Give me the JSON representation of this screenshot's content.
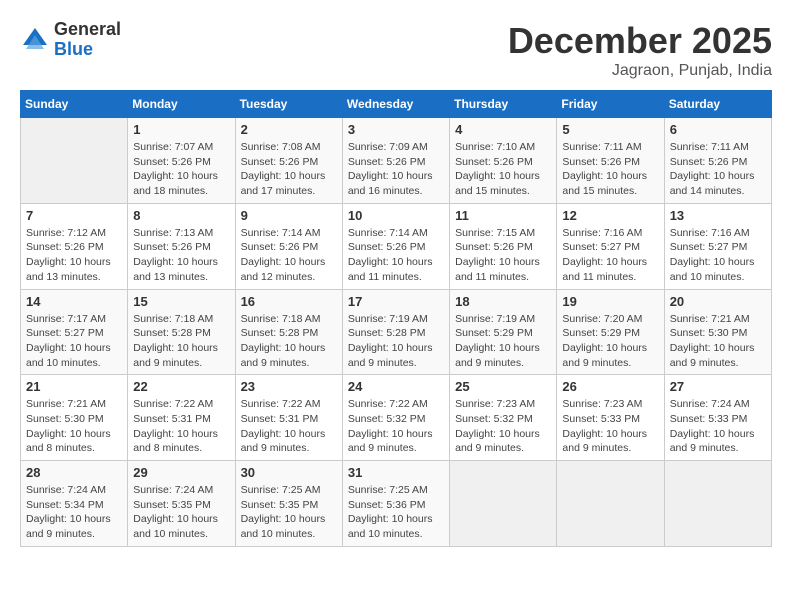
{
  "header": {
    "logo_general": "General",
    "logo_blue": "Blue",
    "month_title": "December 2025",
    "location": "Jagraon, Punjab, India"
  },
  "days_of_week": [
    "Sunday",
    "Monday",
    "Tuesday",
    "Wednesday",
    "Thursday",
    "Friday",
    "Saturday"
  ],
  "weeks": [
    [
      {
        "day": "",
        "info": ""
      },
      {
        "day": "1",
        "info": "Sunrise: 7:07 AM\nSunset: 5:26 PM\nDaylight: 10 hours\nand 18 minutes."
      },
      {
        "day": "2",
        "info": "Sunrise: 7:08 AM\nSunset: 5:26 PM\nDaylight: 10 hours\nand 17 minutes."
      },
      {
        "day": "3",
        "info": "Sunrise: 7:09 AM\nSunset: 5:26 PM\nDaylight: 10 hours\nand 16 minutes."
      },
      {
        "day": "4",
        "info": "Sunrise: 7:10 AM\nSunset: 5:26 PM\nDaylight: 10 hours\nand 15 minutes."
      },
      {
        "day": "5",
        "info": "Sunrise: 7:11 AM\nSunset: 5:26 PM\nDaylight: 10 hours\nand 15 minutes."
      },
      {
        "day": "6",
        "info": "Sunrise: 7:11 AM\nSunset: 5:26 PM\nDaylight: 10 hours\nand 14 minutes."
      }
    ],
    [
      {
        "day": "7",
        "info": "Sunrise: 7:12 AM\nSunset: 5:26 PM\nDaylight: 10 hours\nand 13 minutes."
      },
      {
        "day": "8",
        "info": "Sunrise: 7:13 AM\nSunset: 5:26 PM\nDaylight: 10 hours\nand 13 minutes."
      },
      {
        "day": "9",
        "info": "Sunrise: 7:14 AM\nSunset: 5:26 PM\nDaylight: 10 hours\nand 12 minutes."
      },
      {
        "day": "10",
        "info": "Sunrise: 7:14 AM\nSunset: 5:26 PM\nDaylight: 10 hours\nand 11 minutes."
      },
      {
        "day": "11",
        "info": "Sunrise: 7:15 AM\nSunset: 5:26 PM\nDaylight: 10 hours\nand 11 minutes."
      },
      {
        "day": "12",
        "info": "Sunrise: 7:16 AM\nSunset: 5:27 PM\nDaylight: 10 hours\nand 11 minutes."
      },
      {
        "day": "13",
        "info": "Sunrise: 7:16 AM\nSunset: 5:27 PM\nDaylight: 10 hours\nand 10 minutes."
      }
    ],
    [
      {
        "day": "14",
        "info": "Sunrise: 7:17 AM\nSunset: 5:27 PM\nDaylight: 10 hours\nand 10 minutes."
      },
      {
        "day": "15",
        "info": "Sunrise: 7:18 AM\nSunset: 5:28 PM\nDaylight: 10 hours\nand 9 minutes."
      },
      {
        "day": "16",
        "info": "Sunrise: 7:18 AM\nSunset: 5:28 PM\nDaylight: 10 hours\nand 9 minutes."
      },
      {
        "day": "17",
        "info": "Sunrise: 7:19 AM\nSunset: 5:28 PM\nDaylight: 10 hours\nand 9 minutes."
      },
      {
        "day": "18",
        "info": "Sunrise: 7:19 AM\nSunset: 5:29 PM\nDaylight: 10 hours\nand 9 minutes."
      },
      {
        "day": "19",
        "info": "Sunrise: 7:20 AM\nSunset: 5:29 PM\nDaylight: 10 hours\nand 9 minutes."
      },
      {
        "day": "20",
        "info": "Sunrise: 7:21 AM\nSunset: 5:30 PM\nDaylight: 10 hours\nand 9 minutes."
      }
    ],
    [
      {
        "day": "21",
        "info": "Sunrise: 7:21 AM\nSunset: 5:30 PM\nDaylight: 10 hours\nand 8 minutes."
      },
      {
        "day": "22",
        "info": "Sunrise: 7:22 AM\nSunset: 5:31 PM\nDaylight: 10 hours\nand 8 minutes."
      },
      {
        "day": "23",
        "info": "Sunrise: 7:22 AM\nSunset: 5:31 PM\nDaylight: 10 hours\nand 9 minutes."
      },
      {
        "day": "24",
        "info": "Sunrise: 7:22 AM\nSunset: 5:32 PM\nDaylight: 10 hours\nand 9 minutes."
      },
      {
        "day": "25",
        "info": "Sunrise: 7:23 AM\nSunset: 5:32 PM\nDaylight: 10 hours\nand 9 minutes."
      },
      {
        "day": "26",
        "info": "Sunrise: 7:23 AM\nSunset: 5:33 PM\nDaylight: 10 hours\nand 9 minutes."
      },
      {
        "day": "27",
        "info": "Sunrise: 7:24 AM\nSunset: 5:33 PM\nDaylight: 10 hours\nand 9 minutes."
      }
    ],
    [
      {
        "day": "28",
        "info": "Sunrise: 7:24 AM\nSunset: 5:34 PM\nDaylight: 10 hours\nand 9 minutes."
      },
      {
        "day": "29",
        "info": "Sunrise: 7:24 AM\nSunset: 5:35 PM\nDaylight: 10 hours\nand 10 minutes."
      },
      {
        "day": "30",
        "info": "Sunrise: 7:25 AM\nSunset: 5:35 PM\nDaylight: 10 hours\nand 10 minutes."
      },
      {
        "day": "31",
        "info": "Sunrise: 7:25 AM\nSunset: 5:36 PM\nDaylight: 10 hours\nand 10 minutes."
      },
      {
        "day": "",
        "info": ""
      },
      {
        "day": "",
        "info": ""
      },
      {
        "day": "",
        "info": ""
      }
    ]
  ]
}
